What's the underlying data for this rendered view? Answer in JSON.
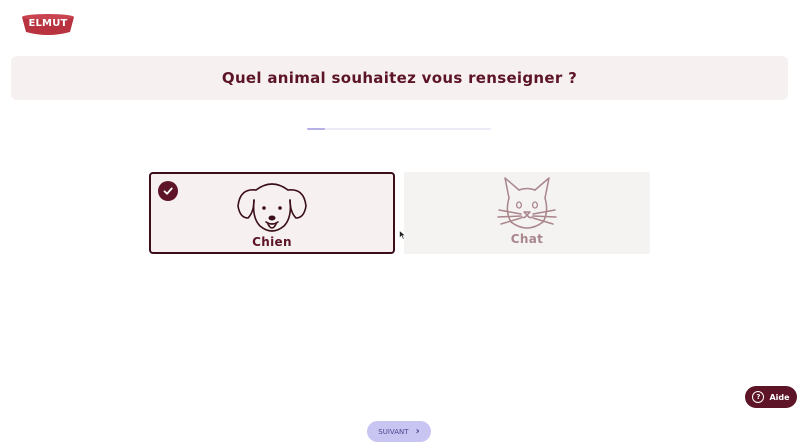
{
  "brand": {
    "logo_text": "ELMUT"
  },
  "question": {
    "title": "Quel animal souhaitez vous renseigner ?"
  },
  "progress": {
    "value": 0.1
  },
  "options": [
    {
      "label": "Chien",
      "icon": "dog-icon",
      "selected": true
    },
    {
      "label": "Chat",
      "icon": "cat-icon",
      "selected": false
    }
  ],
  "help": {
    "label": "Aide",
    "icon": "question-icon"
  },
  "footer": {
    "next_label": "SUIVANT",
    "next_icon": "chevron-right-icon"
  },
  "colors": {
    "brand": "#5c1426",
    "banner_bg": "#f6f1f0",
    "accent": "#c9c5f2",
    "logo_red": "#b8323f"
  }
}
